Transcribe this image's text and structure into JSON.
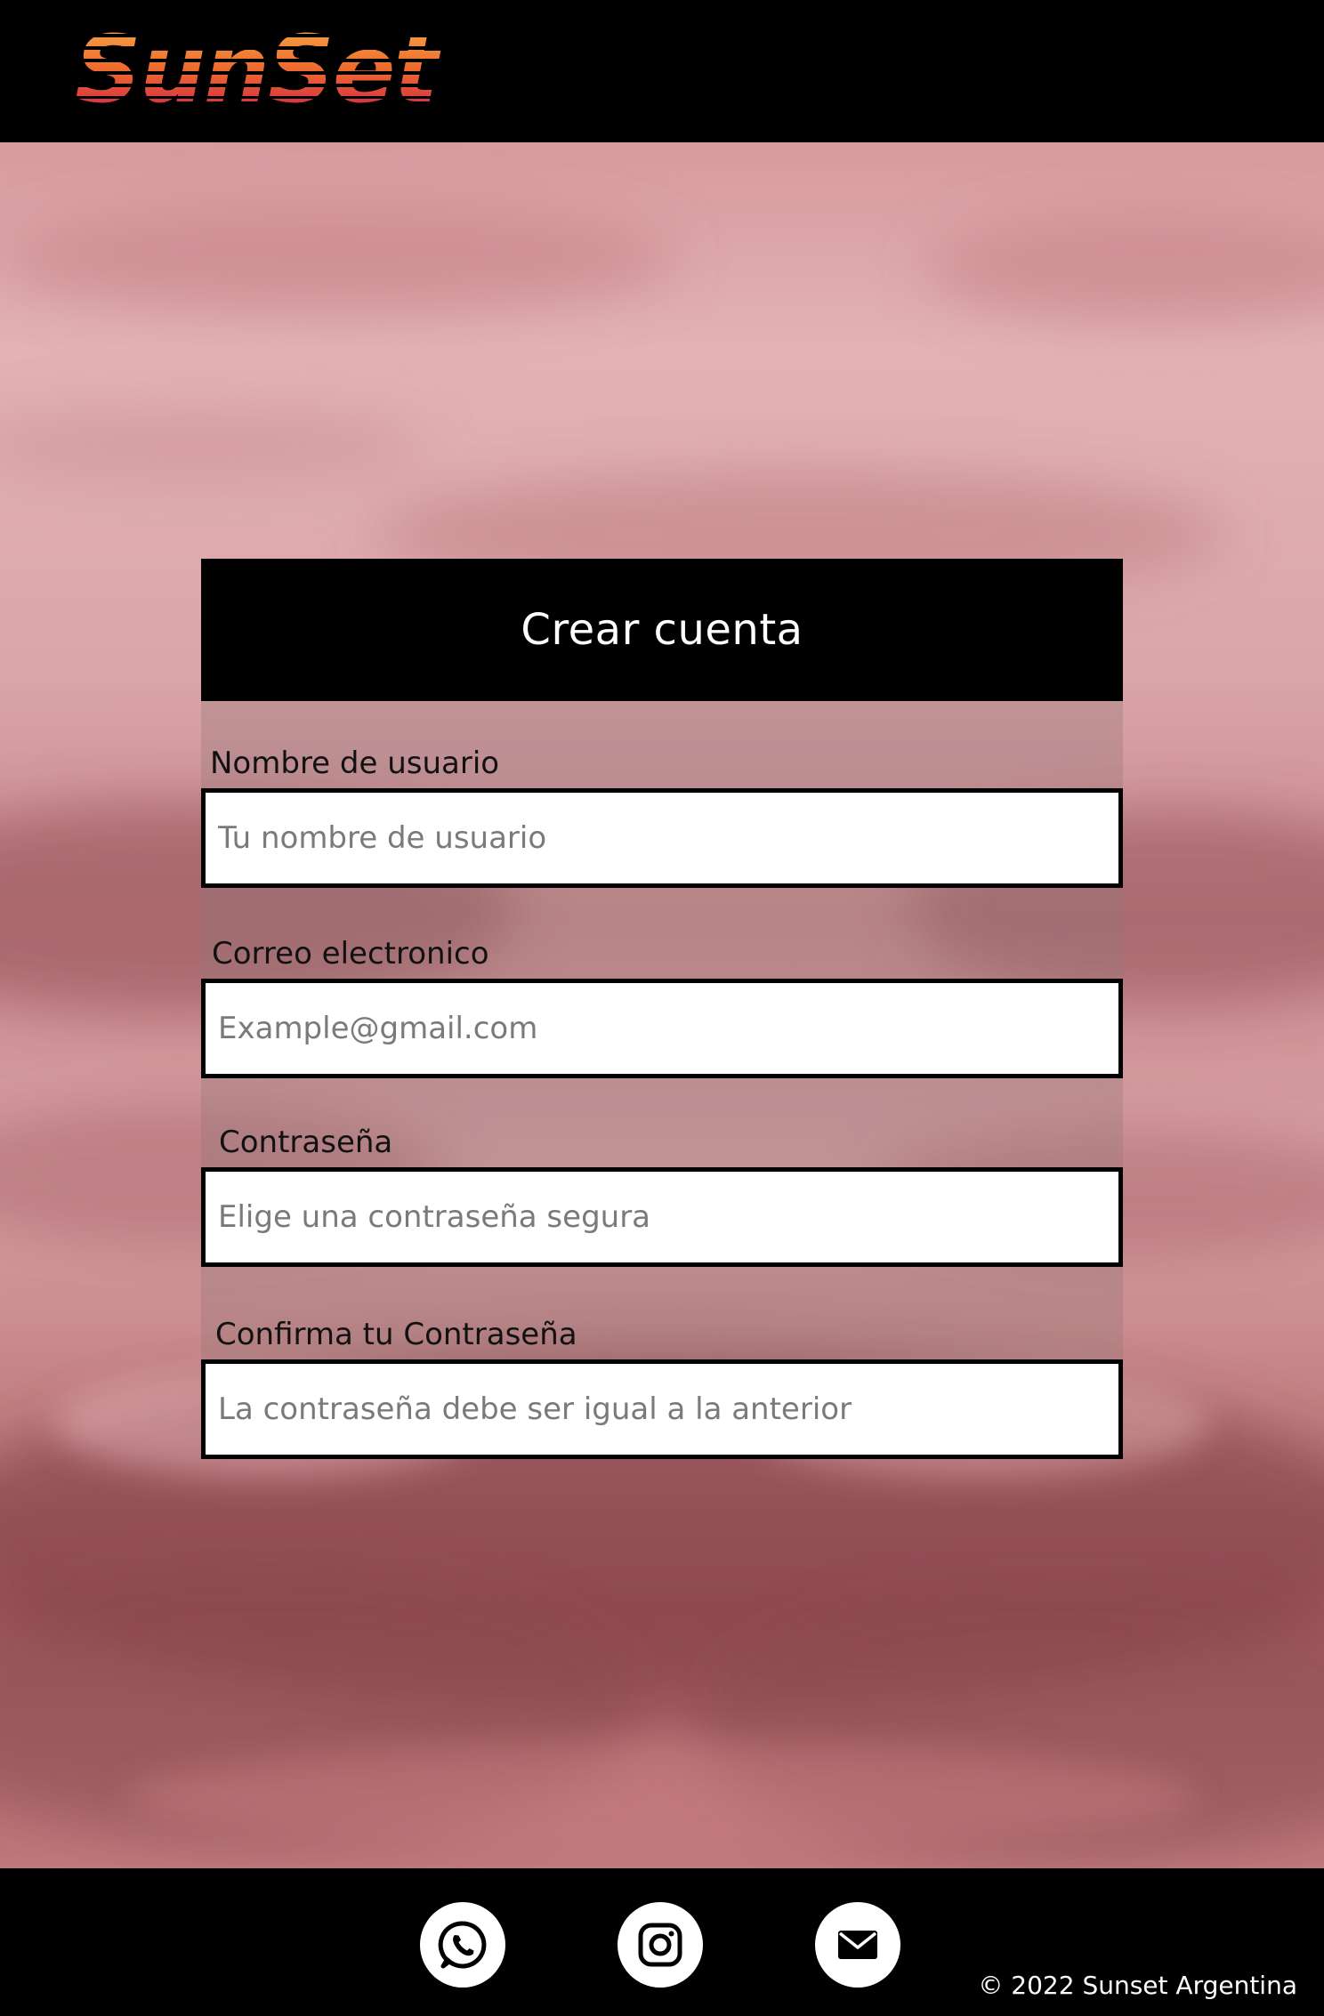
{
  "header": {
    "logo_text": "SunSet"
  },
  "form": {
    "title": "Crear cuenta",
    "fields": [
      {
        "label": "Nombre de usuario",
        "placeholder": "Tu nombre de usuario",
        "value": ""
      },
      {
        "label": "Correo electronico",
        "placeholder": "Example@gmail.com",
        "value": ""
      },
      {
        "label": "Contraseña",
        "placeholder": "Elige una contraseña segura",
        "value": ""
      },
      {
        "label": "Confirma tu Contraseña",
        "placeholder": "La contraseña debe ser igual a la anterior",
        "value": ""
      }
    ]
  },
  "footer": {
    "social_icons": [
      "whatsapp-icon",
      "instagram-icon",
      "mail-icon"
    ],
    "copyright": "© 2022 Sunset Argentina"
  },
  "colors": {
    "header_bg": "#000000",
    "logo_gradient_top": "#f2a03a",
    "logo_gradient_bottom": "#d0234f",
    "sky_pink": "#d9a3a7",
    "form_title_bg": "#000000",
    "input_bg": "#ffffff",
    "footer_bg": "#000000"
  }
}
